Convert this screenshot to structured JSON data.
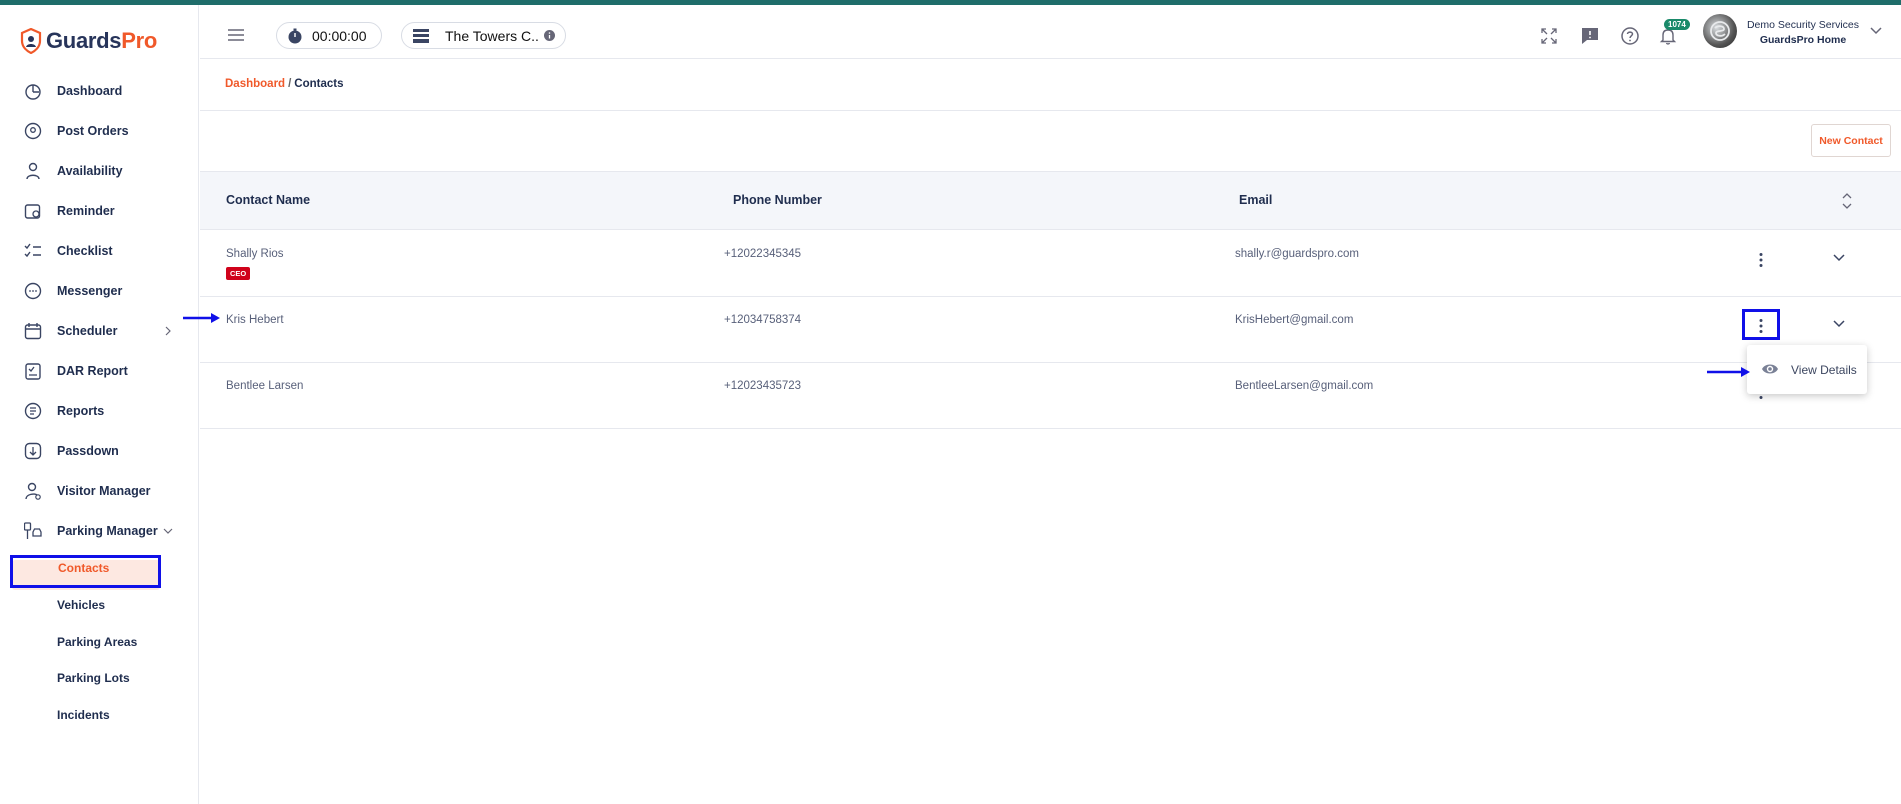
{
  "brand": {
    "part1": "Guards",
    "part2": "Pro"
  },
  "sidebar": {
    "items": [
      {
        "label": "Dashboard",
        "icon": "dashboard-icon"
      },
      {
        "label": "Post Orders",
        "icon": "post-orders-icon"
      },
      {
        "label": "Availability",
        "icon": "availability-icon"
      },
      {
        "label": "Reminder",
        "icon": "reminder-icon"
      },
      {
        "label": "Checklist",
        "icon": "checklist-icon"
      },
      {
        "label": "Messenger",
        "icon": "messenger-icon"
      },
      {
        "label": "Scheduler",
        "icon": "scheduler-icon"
      },
      {
        "label": "DAR Report",
        "icon": "dar-report-icon"
      },
      {
        "label": "Reports",
        "icon": "reports-icon"
      },
      {
        "label": "Passdown",
        "icon": "passdown-icon"
      },
      {
        "label": "Visitor Manager",
        "icon": "visitor-manager-icon"
      },
      {
        "label": "Parking Manager",
        "icon": "parking-manager-icon"
      }
    ],
    "sub_items": [
      "Contacts",
      "Vehicles",
      "Parking Areas",
      "Parking Lots",
      "Incidents"
    ],
    "active_sub": "Contacts"
  },
  "header": {
    "timer": "00:00:00",
    "site": "The Towers C..",
    "notification_count": "1074",
    "company": "Demo Security Services",
    "location": "GuardsPro Home"
  },
  "breadcrumb": {
    "home": "Dashboard",
    "separator": "/",
    "current": "Contacts"
  },
  "new_contact_label": "New Contact",
  "table": {
    "columns": [
      "Contact Name",
      "Phone Number",
      "Email"
    ],
    "rows": [
      {
        "name": "Shally Rios",
        "phone": "+12022345345",
        "email": "shally.r@guardspro.com",
        "tag": "CEO"
      },
      {
        "name": "Kris Hebert",
        "phone": "+12034758374",
        "email": "KrisHebert@gmail.com"
      },
      {
        "name": "Bentlee Larsen",
        "phone": "+12023435723",
        "email": "BentleeLarsen@gmail.com"
      }
    ]
  },
  "row_menu": {
    "view_details": "View Details"
  },
  "colors": {
    "accent": "#f0592a",
    "navy": "#1f2d4e",
    "highlight": "#1010e8",
    "tag": "#d0021b",
    "badge": "#1a8a6a"
  }
}
